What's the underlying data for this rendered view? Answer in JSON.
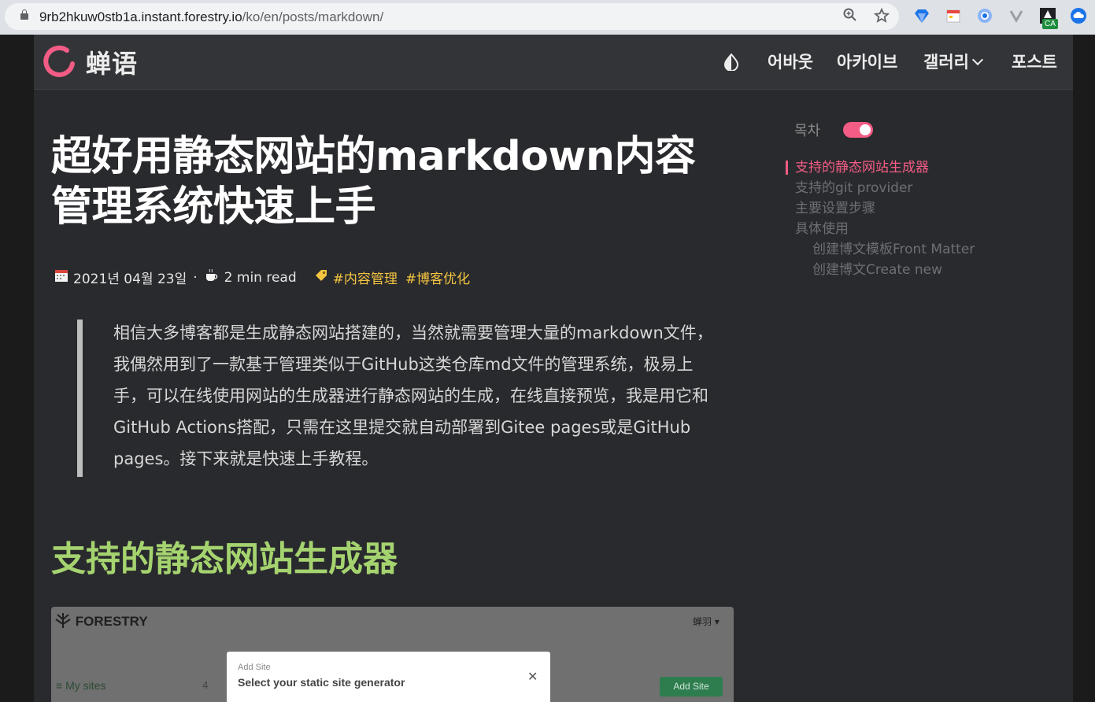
{
  "browser": {
    "url_host": "9rb2hkuw0stb1a.instant.forestry.io",
    "url_path": "/ko/en/posts/markdown/",
    "extension_badge": "CA"
  },
  "header": {
    "brand": "蝉语",
    "nav": [
      "어바웃",
      "아카이브",
      "갤러리",
      "포스트"
    ]
  },
  "post": {
    "title": "超好用静态网站的markdown内容管理系统快速上手",
    "date": "2021년 04월 23일",
    "read_time": "2 min read",
    "tags": [
      "#内容管理",
      "#博客优化"
    ],
    "quote": "相信大多博客都是生成静态网站搭建的，当然就需要管理大量的markdown文件，我偶然用到了一款基于管理类似于GitHub这类仓库md文件的管理系统，极易上手，可以在线使用网站的生成器进行静态网站的生成，在线直接预览，我是用它和GitHub Actions搭配，只需在这里提交就自动部署到Gitee pages或是GitHub pages。接下来就是快速上手教程。",
    "section_heading": "支持的静态网站生成器"
  },
  "screenshot": {
    "brand": "FORESTRY",
    "user": "蝉羽 ▾",
    "my_sites": "My sites",
    "count": "4",
    "modal_small": "Add Site",
    "modal_title": "Select your static site generator",
    "add_button": "Add Site"
  },
  "toc": {
    "label": "목차",
    "enabled": true,
    "items": [
      {
        "text": "支持的静态网站生成器",
        "level": 1,
        "active": true
      },
      {
        "text": "支持的git provider",
        "level": 1,
        "active": false
      },
      {
        "text": "主要设置步骤",
        "level": 1,
        "active": false
      },
      {
        "text": "具体使用",
        "level": 1,
        "active": false
      },
      {
        "text": "创建博文模板Front Matter",
        "level": 2,
        "active": false
      },
      {
        "text": "创建博文Create new",
        "level": 2,
        "active": false
      }
    ]
  },
  "colors": {
    "accent": "#f25c85",
    "heading_green": "#a5d36f",
    "tag_yellow": "#f5c542"
  }
}
